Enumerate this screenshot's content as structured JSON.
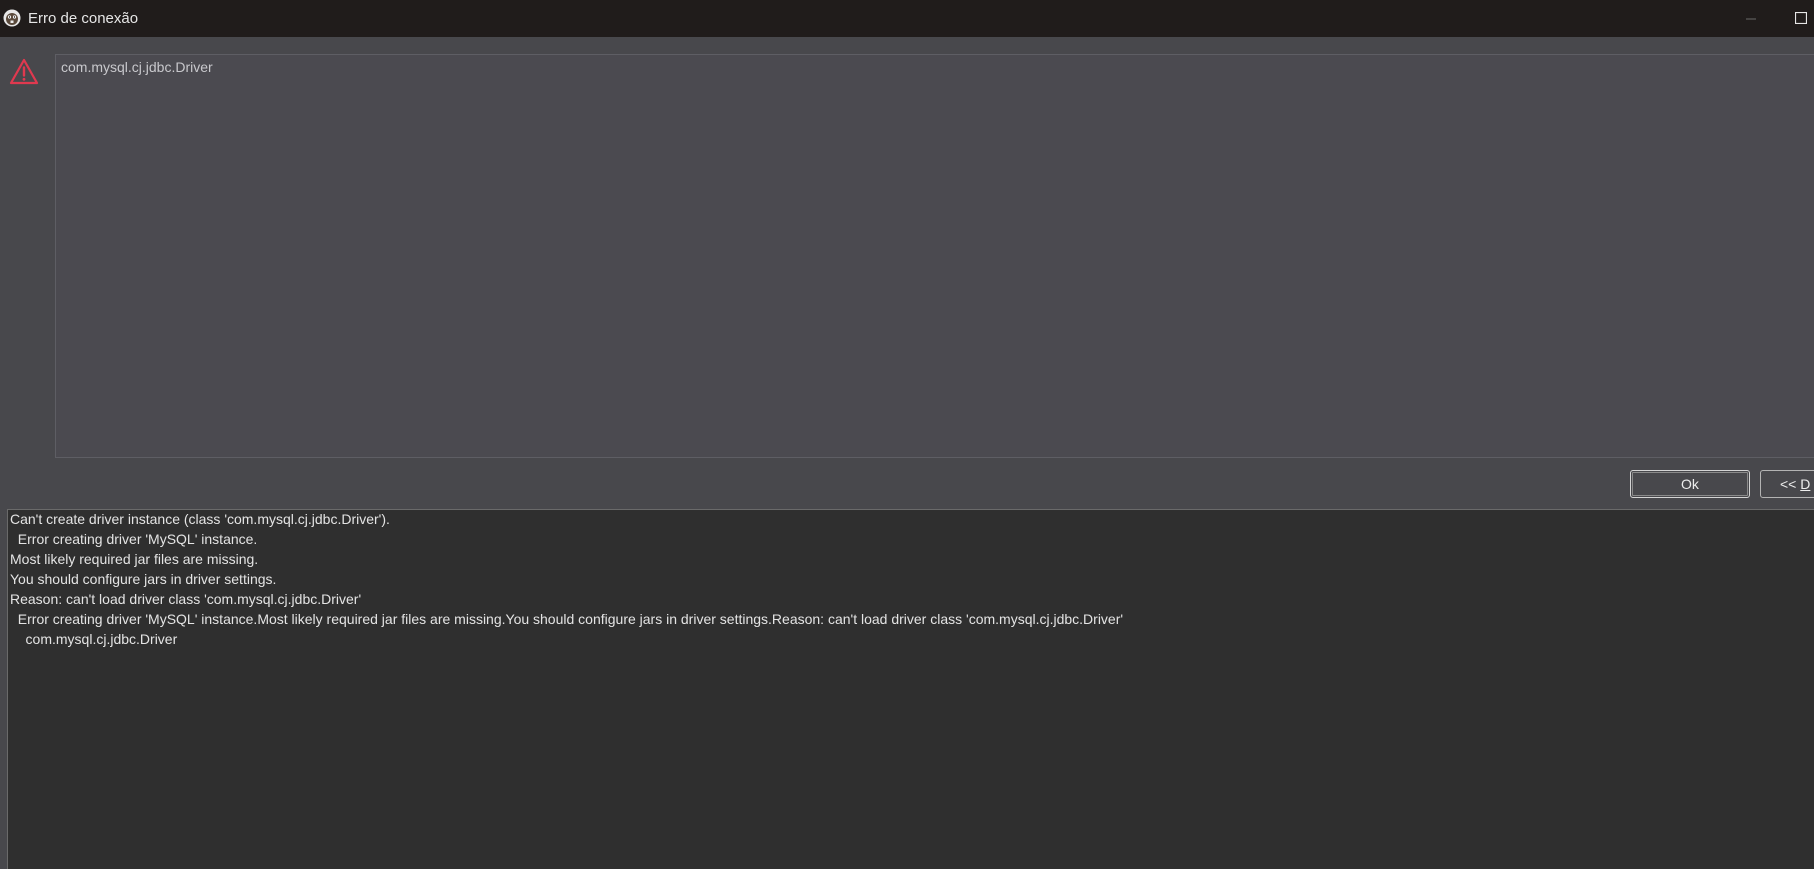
{
  "window": {
    "title": "Erro de conexão",
    "icon": "dbeaver-beaver-icon"
  },
  "message": {
    "icon": "warning-triangle-icon",
    "text": "com.mysql.cj.jdbc.Driver"
  },
  "buttons": {
    "ok_label": "Ok",
    "details_prefix": "<< ",
    "details_label": "D"
  },
  "details": {
    "lines": [
      "Can't create driver instance (class 'com.mysql.cj.jdbc.Driver').",
      "  Error creating driver 'MySQL' instance.",
      "Most likely required jar files are missing.",
      "You should configure jars in driver settings.",
      "Reason: can't load driver class 'com.mysql.cj.jdbc.Driver'",
      "  Error creating driver 'MySQL' instance.Most likely required jar files are missing.You should configure jars in driver settings.Reason: can't load driver class 'com.mysql.cj.jdbc.Driver'",
      "    com.mysql.cj.jdbc.Driver"
    ]
  },
  "colors": {
    "titlebar": "#201c1b",
    "dialog_bg": "#48484c",
    "details_bg": "#2f2f2f",
    "warning": "#e0394f"
  }
}
